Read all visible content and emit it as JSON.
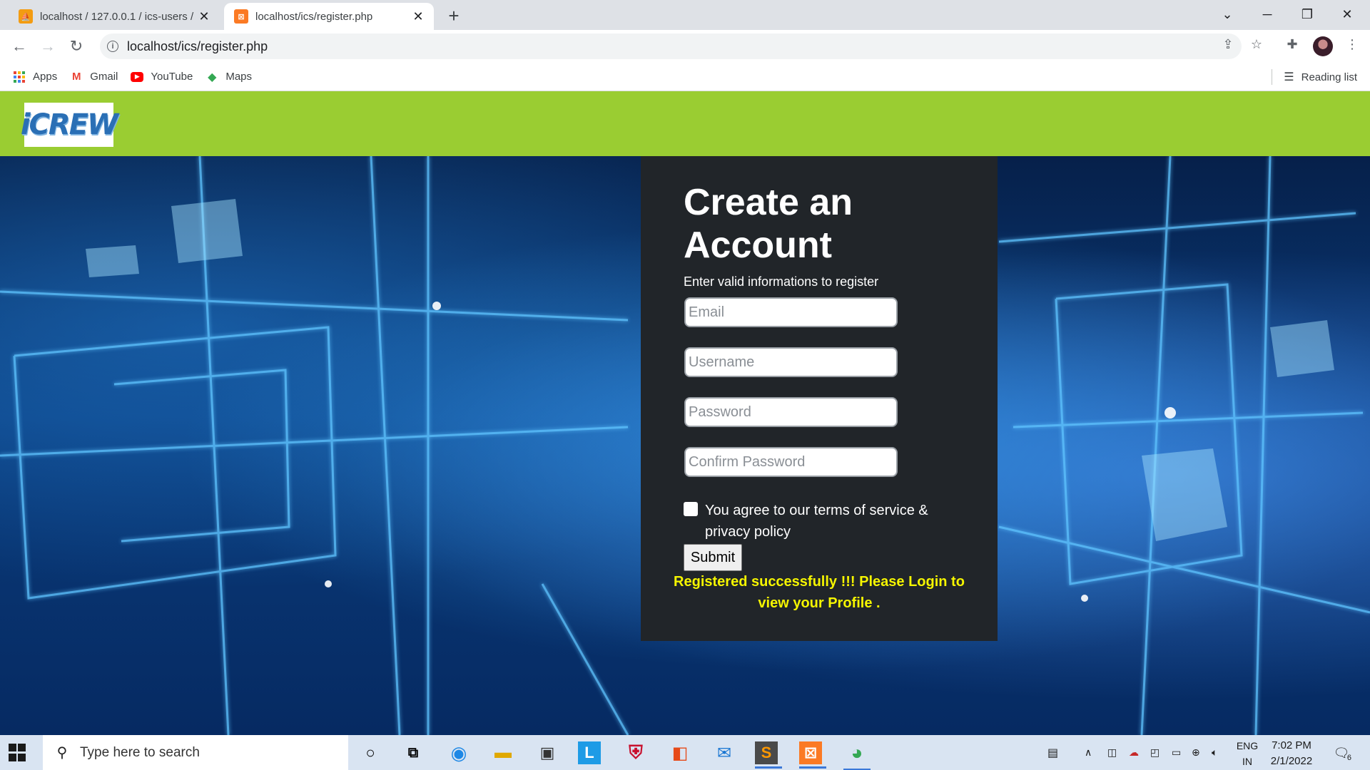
{
  "browser": {
    "tabs": [
      {
        "title": "localhost / 127.0.0.1 / ics-users /",
        "favicon": "phpmyadmin-icon",
        "close": "✕"
      },
      {
        "title": "localhost/ics/register.php",
        "favicon": "xampp-icon",
        "close": "✕"
      }
    ],
    "new_tab": "+",
    "url": "localhost/ics/register.php",
    "bookmarks": [
      {
        "label": "Apps",
        "icon": "apps-grid-icon"
      },
      {
        "label": "Gmail",
        "icon": "gmail-icon"
      },
      {
        "label": "YouTube",
        "icon": "youtube-icon"
      },
      {
        "label": "Maps",
        "icon": "maps-icon"
      }
    ],
    "reading_list": "Reading list"
  },
  "site": {
    "logo_text": "iCREW",
    "brand_color": "#9acd32"
  },
  "form": {
    "title": "Create an Account",
    "subtitle": "Enter valid informations to register",
    "fields": [
      {
        "placeholder": "Email"
      },
      {
        "placeholder": "Username"
      },
      {
        "placeholder": "Password"
      },
      {
        "placeholder": "Confirm Password"
      }
    ],
    "terms": "You agree to our terms of service & privacy policy",
    "submit": "Submit",
    "success_message": "Registered successfully !!! Please Login to view your Profile .",
    "success_color": "#f5f500"
  },
  "taskbar": {
    "search_placeholder": "Type here to search",
    "apps": [
      "cortana-icon",
      "task-view-icon",
      "edge-icon",
      "file-explorer-icon",
      "store-icon",
      "l-app-icon",
      "mcafee-icon",
      "office-icon",
      "mail-icon",
      "sublime-text-icon",
      "xampp-icon",
      "chrome-icon"
    ],
    "lang_line1": "ENG",
    "lang_line2": "IN",
    "time": "7:02 PM",
    "date": "2/1/2022",
    "notification_count": "6"
  }
}
